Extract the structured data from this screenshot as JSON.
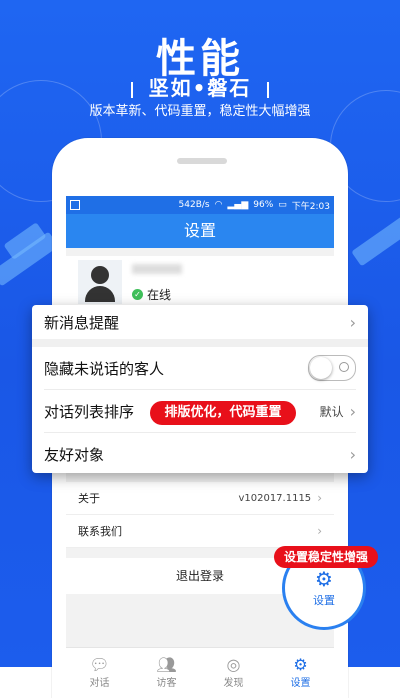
{
  "hero": {
    "title": "性能",
    "subtitle": "坚如•磐石",
    "description": "版本革新、代码重置，稳定性大幅增强"
  },
  "status_bar": {
    "speed": "542B/s",
    "battery": "96%",
    "time": "下午2:03"
  },
  "nav": {
    "title": "设置"
  },
  "profile": {
    "status": "在线"
  },
  "popup": {
    "rows": [
      {
        "label": "新消息提醒"
      },
      {
        "label": "隐藏未说话的客人"
      },
      {
        "label": "对话列表排序",
        "value": "默认"
      },
      {
        "label": "友好对象"
      }
    ]
  },
  "settings_rows": [
    {
      "label": "关于",
      "value": "v102017.1115"
    },
    {
      "label": "联系我们",
      "value": ""
    }
  ],
  "logout": "退出登录",
  "tabs": [
    {
      "label": "对话",
      "icon": "chat-icon"
    },
    {
      "label": "访客",
      "icon": "visitors-icon"
    },
    {
      "label": "发现",
      "icon": "compass-icon"
    },
    {
      "label": "设置",
      "icon": "gear-icon"
    }
  ],
  "badges": {
    "optimize": "排版优化，代码重置",
    "stability": "设置稳定性增强"
  },
  "float": {
    "label": "设置"
  },
  "colors": {
    "primary": "#1f6fe6",
    "badge_red": "#e8101a"
  }
}
